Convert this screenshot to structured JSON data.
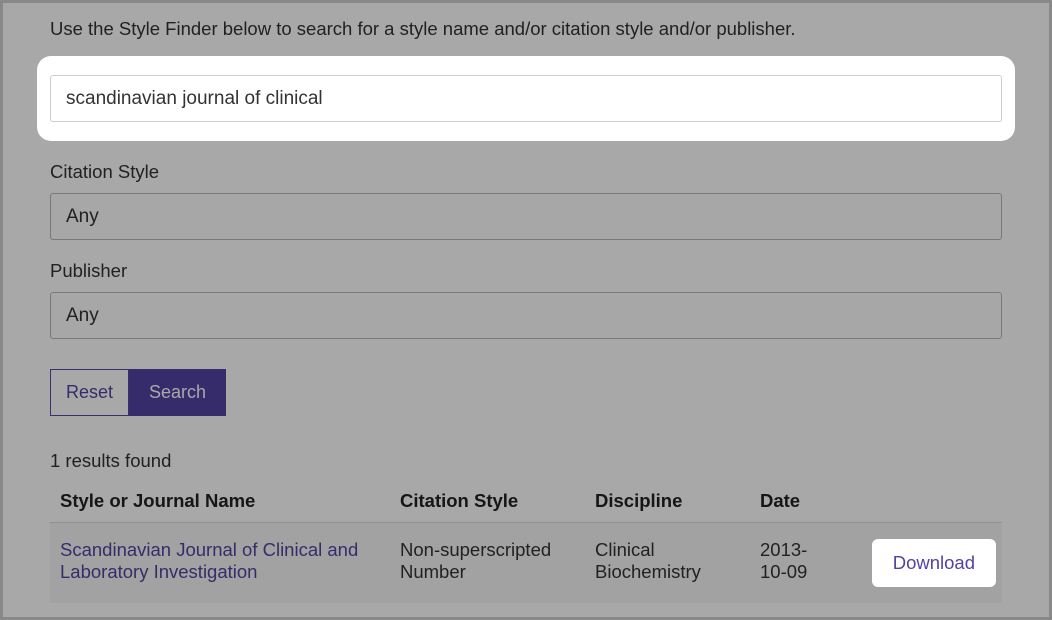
{
  "instruction": "Use the Style Finder below to search for a style name and/or citation style and/or publisher.",
  "searchInput": {
    "value": "scandinavian journal of clinical"
  },
  "citationStyle": {
    "label": "Citation Style",
    "value": "Any"
  },
  "publisher": {
    "label": "Publisher",
    "value": "Any"
  },
  "buttons": {
    "reset": "Reset",
    "search": "Search"
  },
  "results": {
    "countText": "1 results found",
    "headers": {
      "name": "Style or Journal Name",
      "citation": "Citation Style",
      "discipline": "Discipline",
      "date": "Date"
    },
    "rows": [
      {
        "name": "Scandinavian Journal of Clinical and Laboratory Investigation",
        "citation": "Non-superscripted Number",
        "discipline": "Clinical Biochemistry",
        "date": "2013-10-09",
        "action": "Download"
      }
    ]
  }
}
